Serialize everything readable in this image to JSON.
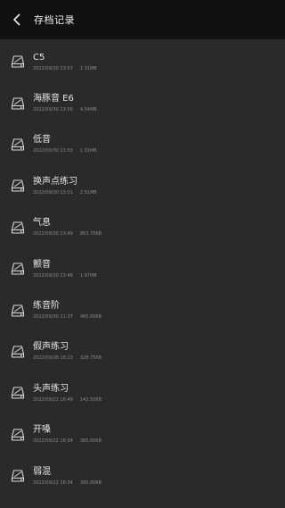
{
  "header": {
    "title": "存档记录"
  },
  "recordings": [
    {
      "name": "C5",
      "date": "2022/09/30 13:57",
      "size": "1.31MB"
    },
    {
      "name": "海豚音 E6",
      "date": "2022/09/30 13:56",
      "size": "4.54MB"
    },
    {
      "name": "低音",
      "date": "2022/09/30 13:53",
      "size": "1.01MB"
    },
    {
      "name": "换声点练习",
      "date": "2022/09/30 13:51",
      "size": "2.51MB"
    },
    {
      "name": "气息",
      "date": "2022/09/30 13:49",
      "size": "863.75KB"
    },
    {
      "name": "颤音",
      "date": "2022/09/30 13:48",
      "size": "1.97MB"
    },
    {
      "name": "练音阶",
      "date": "2022/09/30 11:37",
      "size": "485.00KB"
    },
    {
      "name": "假声练习",
      "date": "2022/09/28 18:13",
      "size": "328.75KB"
    },
    {
      "name": "头声练习",
      "date": "2022/09/22 16:49",
      "size": "142.50KB"
    },
    {
      "name": "开嗓",
      "date": "2022/09/22 16:34",
      "size": "385.00KB"
    },
    {
      "name": "弱混",
      "date": "2022/09/22 16:34",
      "size": "395.00KB"
    }
  ],
  "icons": {
    "back": "chevron-left-icon",
    "file": "disk-icon"
  },
  "colors": {
    "background": "#2a2a2a",
    "header": "#111111",
    "text": "#e6e6e6",
    "meta": "#8a8a8a"
  }
}
